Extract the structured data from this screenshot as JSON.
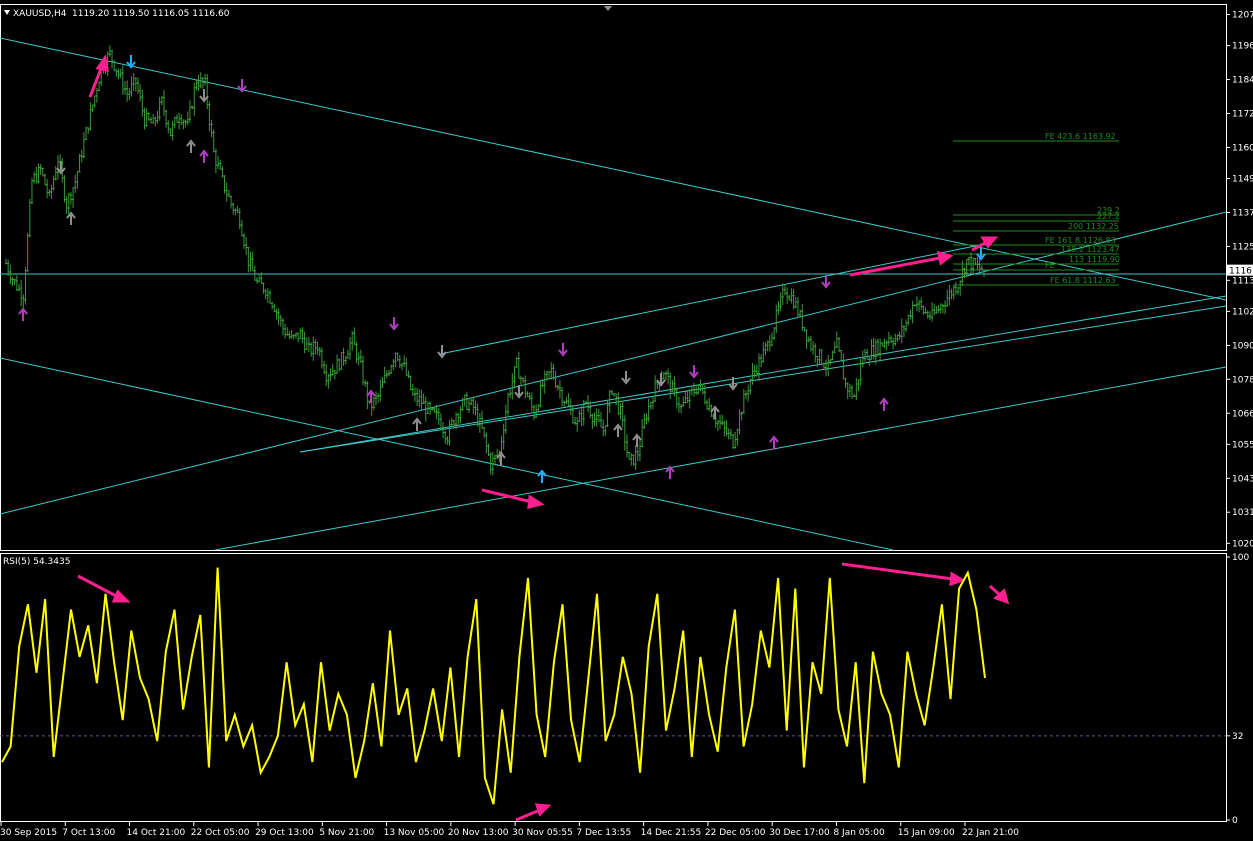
{
  "colors": {
    "background": "#000000",
    "frame": "#ffffff",
    "candles": "#3a9a3a",
    "trendlines": "#40c8c8",
    "fibo": "#228b22",
    "arrows": "#ff1f8e",
    "rsi": "#ffff00",
    "rsi_level": "#7a4a9a",
    "fractal_up_magenta": "#b040c0",
    "fractal_gray": "#909090",
    "fractal_cyan": "#20b0ff"
  },
  "chart_data": [
    {
      "type": "candlestick",
      "title": "XAUUSD,H4",
      "ohlc_label": "1119.20 1119.50 1116.05 1116.60",
      "last_price": 1116.6,
      "last_price_label": "1116",
      "ylim": [
        1018,
        1210
      ],
      "y_ticks": [
        "1207",
        "1196",
        "1184",
        "1172",
        "1160",
        "1149",
        "1137",
        "1125",
        "1113",
        "1102",
        "1090",
        "1078",
        "1066",
        "1055",
        "1043",
        "1031",
        "1020"
      ],
      "y_tick_values": [
        1207,
        1196,
        1184,
        1172,
        1160,
        1149,
        1137,
        1125,
        1113,
        1102,
        1090,
        1078,
        1066,
        1055,
        1043,
        1031,
        1020
      ],
      "x_labels": [
        "30 Sep 2015",
        "7 Oct 13:00",
        "14 Oct 21:00",
        "22 Oct 05:00",
        "29 Oct 13:00",
        "5 Nov 21:00",
        "13 Nov 05:00",
        "20 Nov 13:00",
        "30 Nov 05:55",
        "7 Dec 13:55",
        "14 Dec 21:55",
        "22 Dec 05:00",
        "30 Dec 17:00",
        "8 Jan 05:00",
        "15 Jan 09:00",
        "22 Jan 21:00"
      ],
      "close_path": [
        1119,
        1112,
        1108,
        1148,
        1152,
        1142,
        1156,
        1140,
        1148,
        1162,
        1175,
        1188,
        1193,
        1186,
        1179,
        1183,
        1170,
        1168,
        1176,
        1165,
        1172,
        1168,
        1184,
        1182,
        1158,
        1148,
        1140,
        1135,
        1120,
        1112,
        1110,
        1104,
        1096,
        1092,
        1094,
        1088,
        1090,
        1080,
        1082,
        1086,
        1092,
        1082,
        1068,
        1072,
        1080,
        1088,
        1082,
        1072,
        1070,
        1066,
        1064,
        1058,
        1066,
        1070,
        1068,
        1060,
        1048,
        1052,
        1072,
        1083,
        1074,
        1066,
        1076,
        1081,
        1074,
        1068,
        1062,
        1070,
        1064,
        1060,
        1075,
        1066,
        1048,
        1052,
        1066,
        1075,
        1081,
        1074,
        1068,
        1072,
        1076,
        1070,
        1064,
        1060,
        1056,
        1068,
        1078,
        1084,
        1090,
        1100,
        1110,
        1106,
        1098,
        1090,
        1086,
        1082,
        1090,
        1076,
        1072,
        1086,
        1088,
        1090,
        1093,
        1092,
        1098,
        1106,
        1102,
        1100,
        1104,
        1108,
        1112,
        1120,
        1118,
        1116.6
      ]
    },
    {
      "type": "line",
      "title": "RSI(5) 54.3435",
      "series": [
        {
          "name": "RSI(5)",
          "values": [
            22,
            28,
            66,
            82,
            56,
            84,
            24,
            52,
            80,
            62,
            74,
            52,
            86,
            60,
            38,
            72,
            54,
            46,
            30,
            64,
            80,
            42,
            62,
            78,
            20,
            96,
            30,
            40,
            28,
            36,
            18,
            24,
            32,
            60,
            36,
            44,
            22,
            60,
            34,
            48,
            40,
            16,
            30,
            52,
            28,
            72,
            40,
            50,
            22,
            34,
            50,
            30,
            58,
            24,
            62,
            84,
            16,
            6,
            42,
            18,
            62,
            92,
            40,
            24,
            60,
            82,
            38,
            22,
            54,
            86,
            30,
            40,
            62,
            48,
            18,
            66,
            86,
            34,
            50,
            72,
            24,
            62,
            40,
            26,
            58,
            80,
            28,
            44,
            72,
            58,
            92,
            34,
            88,
            20,
            60,
            48,
            92,
            42,
            28,
            60,
            14,
            64,
            48,
            40,
            20,
            64,
            48,
            36,
            58,
            82,
            46,
            88,
            94,
            80,
            54
          ]
        }
      ],
      "level": 32,
      "level_label": "32",
      "ylim": [
        0,
        100
      ],
      "y_ticks": [
        "100",
        "32",
        "0"
      ],
      "y_tick_values": [
        100,
        32,
        0
      ]
    }
  ],
  "annotations": {
    "fibo_labels": [
      "FE 423.6 1163.92",
      "200 1132.25",
      "FE 161.8 1126.83",
      "138.2 1123.47",
      "113 1119.90",
      "FE 61.8 1112.63",
      "FE"
    ],
    "fibo_levels": [
      1163.92,
      1132.25,
      1126.83,
      1123.47,
      1119.9,
      1112.63,
      1117.8
    ],
    "fibo_extra": [
      "239.2",
      "227.2"
    ]
  }
}
